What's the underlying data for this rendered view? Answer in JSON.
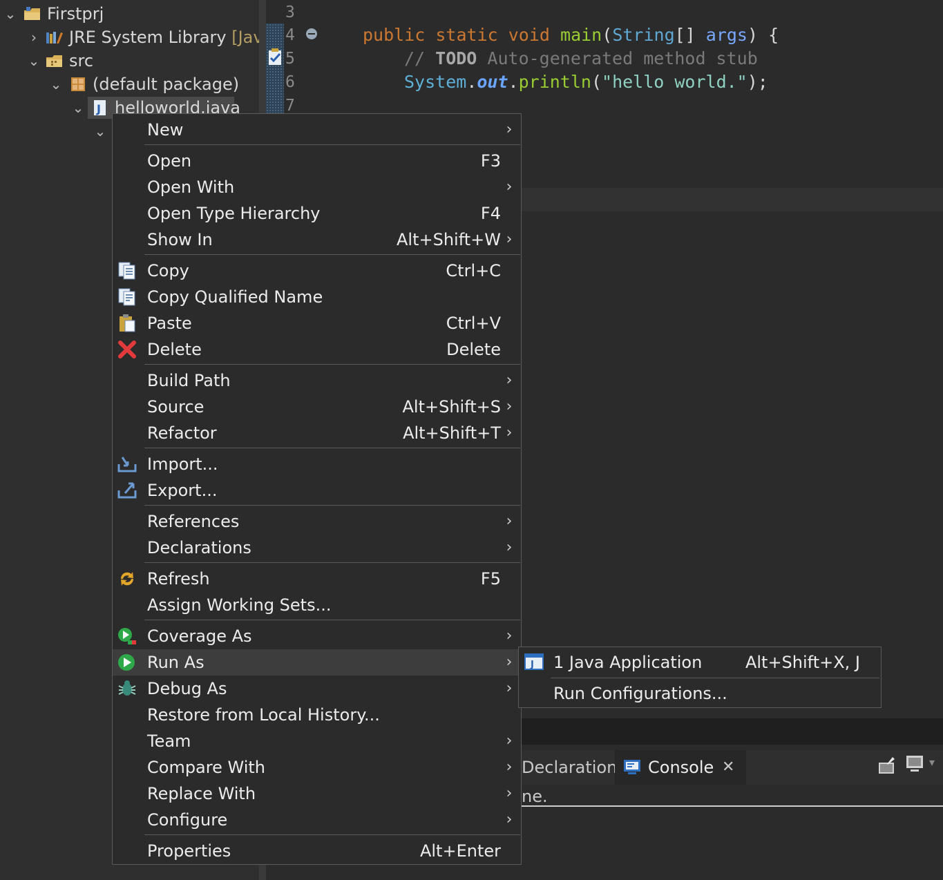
{
  "explorer": {
    "items": [
      {
        "label": "Firstprj",
        "extra": ""
      },
      {
        "label": "JRE System Library",
        "extra": "[Java"
      },
      {
        "label": "src",
        "extra": ""
      },
      {
        "label": "(default package)",
        "extra": ""
      },
      {
        "label": "helloworld.java",
        "extra": ""
      }
    ]
  },
  "editor": {
    "line_numbers": [
      "3",
      "4",
      "5",
      "6",
      "7"
    ],
    "line4": {
      "kw1": "public",
      "kw2": "static",
      "kw3": "void",
      "fn": "main",
      "p1": "(",
      "ty": "String",
      "p2": "[] ",
      "arg": "args",
      "p3": ") {"
    },
    "line5": {
      "c1": "// ",
      "todo": "TODO",
      "c2": " Auto-generated method stub"
    },
    "line6": {
      "sys": "System",
      "d1": ".",
      "fld": "out",
      "d2": ".",
      "fn": "println",
      "p1": "(",
      "str": "\"hello world.\"",
      "p2": ");"
    }
  },
  "context_menu": {
    "items": [
      {
        "label": "New",
        "shortcut": "",
        "submenu": true,
        "icon": ""
      },
      {
        "label": "Open",
        "shortcut": "F3",
        "submenu": false,
        "icon": ""
      },
      {
        "label": "Open With",
        "shortcut": "",
        "submenu": true,
        "icon": ""
      },
      {
        "label": "Open Type Hierarchy",
        "shortcut": "F4",
        "submenu": false,
        "icon": ""
      },
      {
        "label": "Show In",
        "shortcut": "Alt+Shift+W",
        "submenu": true,
        "icon": ""
      },
      {
        "label": "Copy",
        "shortcut": "Ctrl+C",
        "submenu": false,
        "icon": "copy-icon"
      },
      {
        "label": "Copy Qualified Name",
        "shortcut": "",
        "submenu": false,
        "icon": "copy-qualified-icon"
      },
      {
        "label": "Paste",
        "shortcut": "Ctrl+V",
        "submenu": false,
        "icon": "paste-icon"
      },
      {
        "label": "Delete",
        "shortcut": "Delete",
        "submenu": false,
        "icon": "delete-icon"
      },
      {
        "label": "Build Path",
        "shortcut": "",
        "submenu": true,
        "icon": ""
      },
      {
        "label": "Source",
        "shortcut": "Alt+Shift+S",
        "submenu": true,
        "icon": ""
      },
      {
        "label": "Refactor",
        "shortcut": "Alt+Shift+T",
        "submenu": true,
        "icon": ""
      },
      {
        "label": "Import...",
        "shortcut": "",
        "submenu": false,
        "icon": "import-icon"
      },
      {
        "label": "Export...",
        "shortcut": "",
        "submenu": false,
        "icon": "export-icon"
      },
      {
        "label": "References",
        "shortcut": "",
        "submenu": true,
        "icon": ""
      },
      {
        "label": "Declarations",
        "shortcut": "",
        "submenu": true,
        "icon": ""
      },
      {
        "label": "Refresh",
        "shortcut": "F5",
        "submenu": false,
        "icon": "refresh-icon"
      },
      {
        "label": "Assign Working Sets...",
        "shortcut": "",
        "submenu": false,
        "icon": ""
      },
      {
        "label": "Coverage As",
        "shortcut": "",
        "submenu": true,
        "icon": "coverage-icon"
      },
      {
        "label": "Run As",
        "shortcut": "",
        "submenu": true,
        "icon": "run-icon",
        "highlighted": true
      },
      {
        "label": "Debug As",
        "shortcut": "",
        "submenu": true,
        "icon": "debug-icon"
      },
      {
        "label": "Restore from Local History...",
        "shortcut": "",
        "submenu": false,
        "icon": ""
      },
      {
        "label": "Team",
        "shortcut": "",
        "submenu": true,
        "icon": ""
      },
      {
        "label": "Compare With",
        "shortcut": "",
        "submenu": true,
        "icon": ""
      },
      {
        "label": "Replace With",
        "shortcut": "",
        "submenu": true,
        "icon": ""
      },
      {
        "label": "Configure",
        "shortcut": "",
        "submenu": true,
        "icon": ""
      },
      {
        "label": "Properties",
        "shortcut": "Alt+Enter",
        "submenu": false,
        "icon": ""
      }
    ]
  },
  "run_as_submenu": {
    "items": [
      {
        "label": "1 Java Application",
        "shortcut": "Alt+Shift+X, J",
        "icon": "java-app-icon"
      },
      {
        "label": "Run Configurations...",
        "shortcut": "",
        "icon": ""
      }
    ]
  },
  "bottom_panel": {
    "tab_declaration": "Declaration",
    "tab_console": "Console",
    "console_text": "ne."
  },
  "colors": {
    "background": "#2b2b2b",
    "keyword": "#cc7832",
    "menu_highlight": "#3d3d3d"
  }
}
